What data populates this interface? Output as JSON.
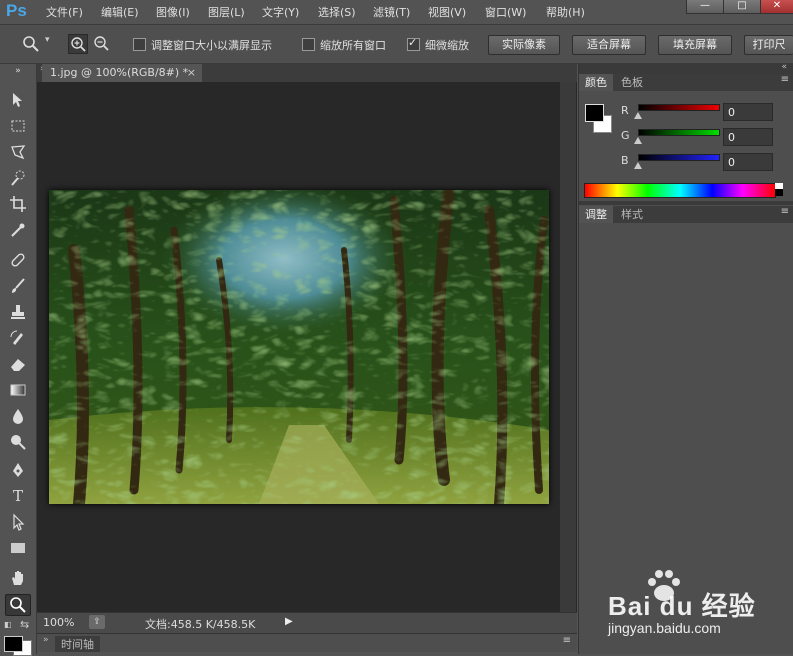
{
  "app": {
    "logo": "Ps"
  },
  "menu": [
    "文件(F)",
    "编辑(E)",
    "图像(I)",
    "图层(L)",
    "文字(Y)",
    "选择(S)",
    "滤镜(T)",
    "视图(V)",
    "窗口(W)",
    "帮助(H)"
  ],
  "window_controls": {
    "minimize": "—",
    "restore": "□",
    "close": "✕"
  },
  "options": {
    "fit_window_label": "调整窗口大小以满屏显示",
    "zoom_all_label": "缩放所有窗口",
    "scrubby_zoom_label": "细微缩放",
    "fit_window_checked": false,
    "zoom_all_checked": false,
    "scrubby_zoom_checked": true,
    "buttons": [
      "实际像素",
      "适合屏幕",
      "填充屏幕",
      "打印尺"
    ]
  },
  "document": {
    "tab_title": "1.jpg @ 100%(RGB/8#) *",
    "tab_close": "×",
    "zoom": "100%",
    "doc_info": "文档:458.5 K/458.5K"
  },
  "timeline": {
    "label": "时间轴"
  },
  "color_panel": {
    "tabs": [
      "颜色",
      "色板"
    ],
    "channels": [
      {
        "label": "R",
        "value": "0"
      },
      {
        "label": "G",
        "value": "0"
      },
      {
        "label": "B",
        "value": "0"
      }
    ],
    "foreground": "#000000",
    "background": "#ffffff"
  },
  "adjust_panel": {
    "tabs": [
      "调整",
      "样式"
    ]
  },
  "watermark": {
    "brand": "Bai du 经验",
    "url": "jingyan.baidu.com"
  }
}
